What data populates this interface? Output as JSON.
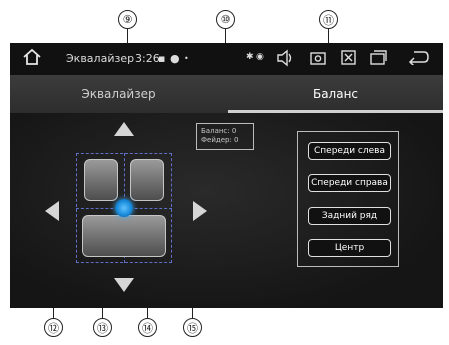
{
  "callouts": {
    "c9": "⑨",
    "c10": "⑩",
    "c11": "⑪",
    "c12": "⑫",
    "c13": "⑬",
    "c14": "⑭",
    "c15": "⑮"
  },
  "statusbar": {
    "title": "Эквалайзер",
    "time": "3:26"
  },
  "tabs": [
    {
      "label": "Эквалайзер",
      "active": false
    },
    {
      "label": "Баланс",
      "active": true
    }
  ],
  "readout": {
    "balance": "Баланс: 0",
    "fader": "Фейдер: 0"
  },
  "buttons": [
    {
      "label": "Спереди слева"
    },
    {
      "label": "Спереди справа"
    },
    {
      "label": "Задний ряд"
    },
    {
      "label": "Центр"
    }
  ],
  "icons": {
    "home": "home-icon",
    "back": "back-icon"
  },
  "colors": {
    "accent": "#1a8bdc",
    "background": "#101010",
    "tab_bar": "#333333"
  }
}
